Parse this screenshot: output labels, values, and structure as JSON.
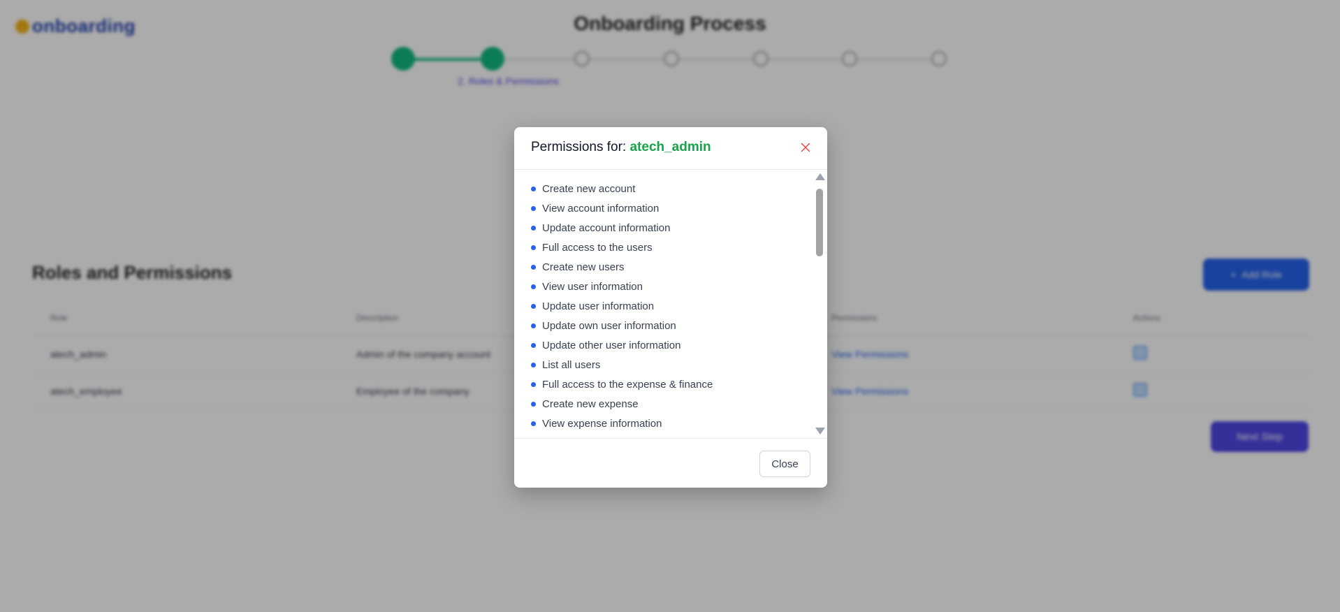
{
  "app": {
    "logo_text": "onboarding",
    "page_title": "Onboarding Process",
    "step_caption": "2. Roles & Permissions"
  },
  "steps": {
    "total": 7,
    "completed": 2
  },
  "roles_section": {
    "title": "Roles and Permissions",
    "add_button_label": "Add Role",
    "columns": [
      "Role",
      "Description",
      "Permissions",
      "Actions"
    ],
    "rows": [
      {
        "role": "atech_admin",
        "description": "Admin of the company account",
        "permissions": "View Permissions"
      },
      {
        "role": "atech_employee",
        "description": "Employee of the company",
        "permissions": "View Permissions"
      }
    ],
    "next_button_label": "Next Step"
  },
  "modal": {
    "title_prefix": "Permissions for: ",
    "role_name": "atech_admin",
    "permissions": [
      "Create new account",
      "View account information",
      "Update account information",
      "Full access to the users",
      "Create new users",
      "View user information",
      "Update user information",
      "Update own user information",
      "Update other user information",
      "List all users",
      "Full access to the expense & finance",
      "Create new expense",
      "View expense information"
    ],
    "close_button_label": "Close"
  },
  "colors": {
    "accent_green": "#16a34a",
    "bullet_blue": "#2563eb",
    "close_icon_red": "#ef4444",
    "overlay": "rgba(0,0,0,0.33)"
  },
  "icons": {
    "modal_close": "close-icon",
    "scroll_up": "arrow-up-icon",
    "scroll_down": "arrow-down-icon"
  }
}
